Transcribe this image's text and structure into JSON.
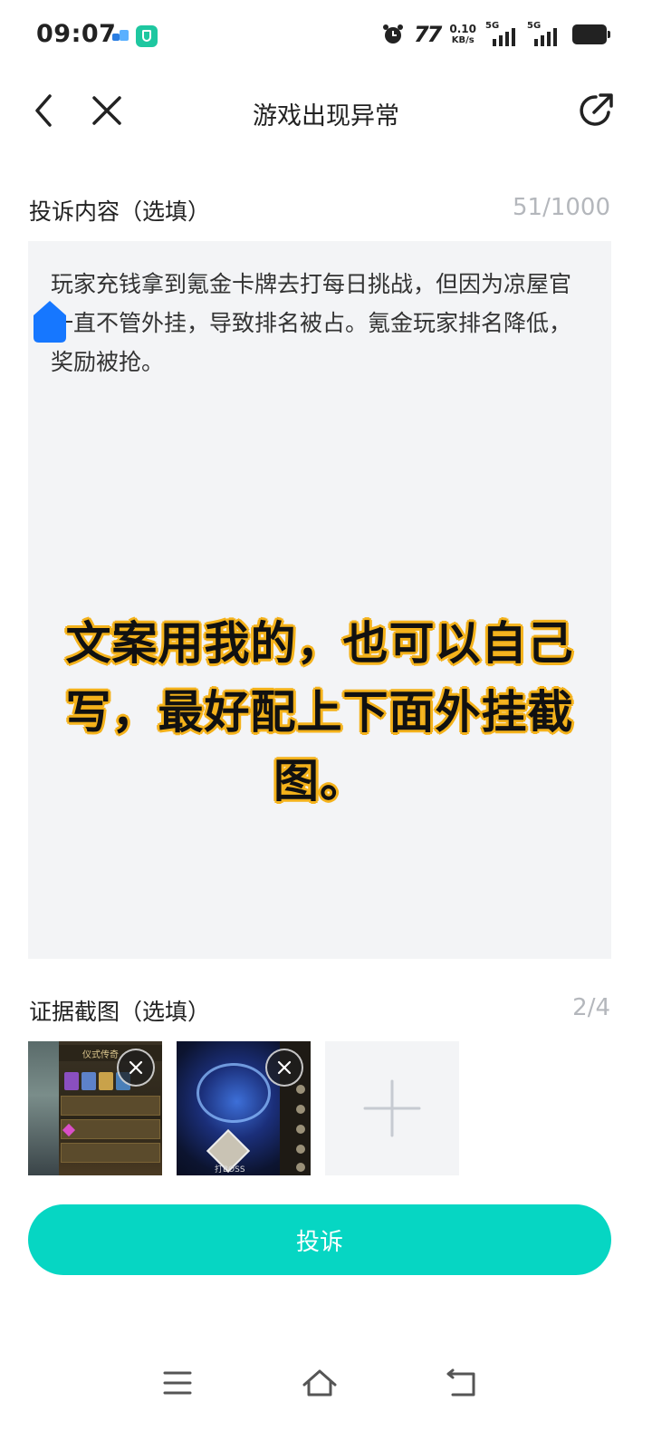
{
  "status_bar": {
    "time": "09:07",
    "nfc_label": "77",
    "net_speed_value": "0.10",
    "net_speed_unit": "KB/s",
    "signal_1_tag": "5G",
    "signal_2_tag": "5G",
    "icons": [
      "app-notification-icon",
      "security-app-icon",
      "alarm-icon",
      "signal-icon",
      "battery-icon"
    ]
  },
  "header": {
    "title": "游戏出现异常",
    "back_icon": "chevron-left-icon",
    "close_icon": "close-icon",
    "share_icon": "share-icon"
  },
  "complaint": {
    "label": "投诉内容（选填）",
    "counter": "51/1000",
    "text": "玩家充钱拿到氪金卡牌去打每日挑战，但因为凉屋官一直不管外挂，导致排名被占。氪金玩家排名降低，奖励被抢。"
  },
  "overlay": {
    "caption": "文案用我的，也可以自己写，最好配上下面外挂截图。",
    "color": "#f4b21b"
  },
  "evidence": {
    "label": "证据截图（选填）",
    "counter": "2/4",
    "thumb_1_title": "仪式传奇",
    "thumb_2_caption": "打BOSS",
    "add_icon": "plus-icon"
  },
  "submit": {
    "label": "投诉",
    "color": "#06d6c3"
  },
  "system_nav": {
    "icons": [
      "menu-icon",
      "home-icon",
      "back-icon"
    ]
  }
}
